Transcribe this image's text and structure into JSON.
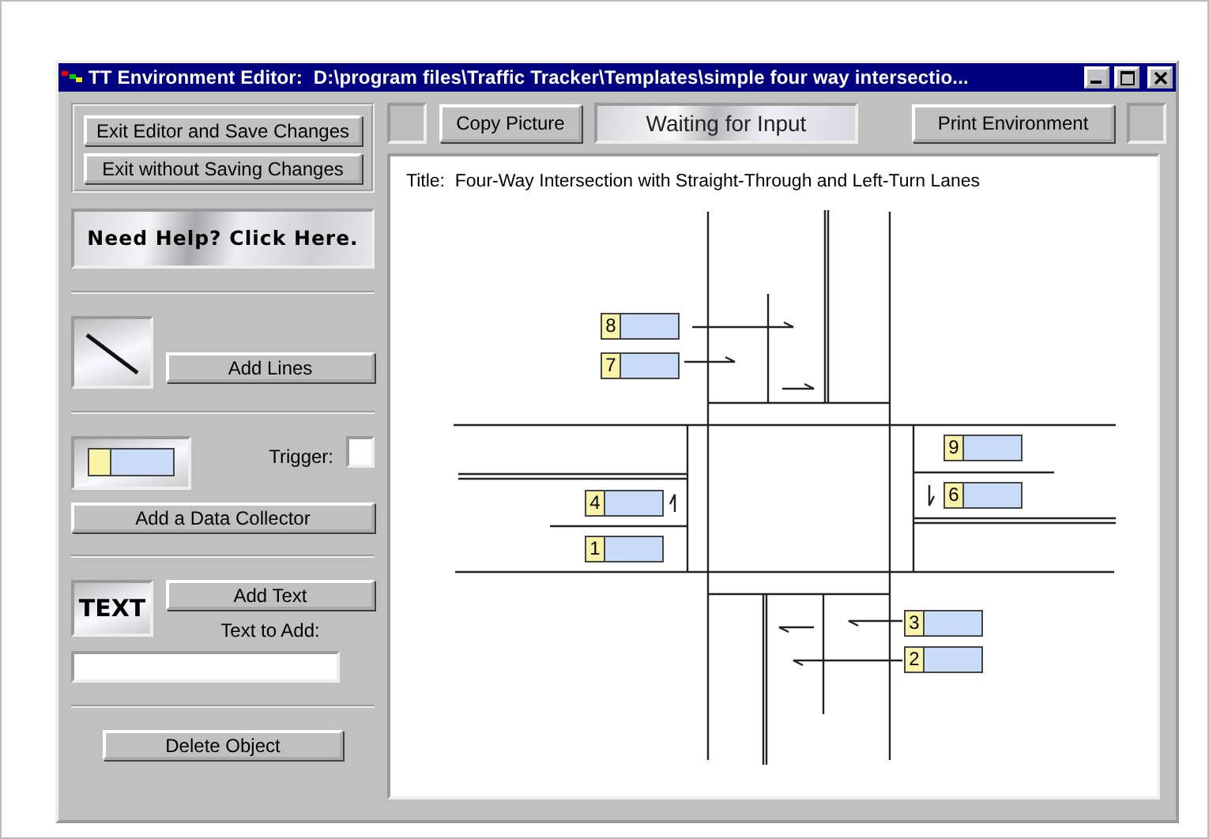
{
  "window": {
    "title": "TT Environment Editor:  D:\\program files\\Traffic Tracker\\Templates\\simple four way intersectio..."
  },
  "file_buttons": [
    "Exit Editor and Save Changes",
    "Exit without Saving Changes"
  ],
  "help_banner": "Need Help? Click Here.",
  "lines_tool": {
    "button": "Add Lines"
  },
  "collector_tool": {
    "trigger_label": "Trigger:",
    "trigger_checked": false,
    "button": "Add a Data Collector"
  },
  "text_tool": {
    "sample": "TEXT",
    "button": "Add Text",
    "field_label": "Text to Add:"
  },
  "delete_button": "Delete Object",
  "toolbar": {
    "copy_button": "Copy Picture",
    "status": "Waiting for Input",
    "print_button": "Print Environment"
  },
  "canvas": {
    "title": "Title:  Four-Way Intersection with Straight-Through and Left-Turn Lanes",
    "collectors": [
      {
        "number": "8"
      },
      {
        "number": "7"
      },
      {
        "number": "9"
      },
      {
        "number": "4"
      },
      {
        "number": "6"
      },
      {
        "number": "1"
      },
      {
        "number": "3"
      },
      {
        "number": "2"
      }
    ]
  }
}
